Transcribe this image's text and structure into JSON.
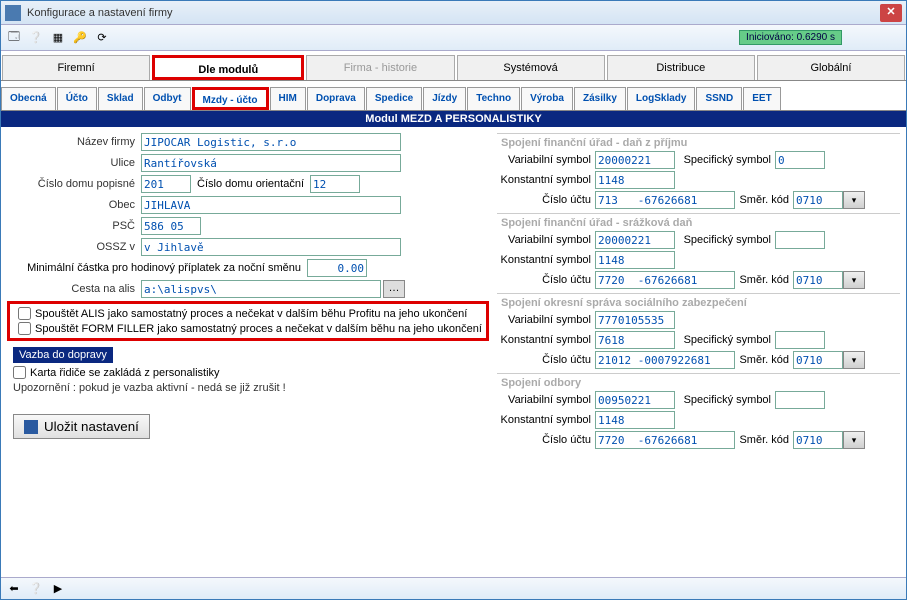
{
  "window": {
    "title": "Konfigurace a nastavení firmy"
  },
  "init_badge": "Iniciováno: 0.6290 s",
  "main_tabs": [
    "Firemní",
    "Dle modulů",
    "Firma - historie",
    "Systémová",
    "Distribuce",
    "Globální"
  ],
  "sub_tabs": [
    "Obecná",
    "Účto",
    "Sklad",
    "Odbyt",
    "Mzdy - účto",
    "HIM",
    "Doprava",
    "Spedice",
    "Jízdy",
    "Techno",
    "Výroba",
    "Zásilky",
    "LogSklady",
    "SSND",
    "EET"
  ],
  "module_header": "Modul  MEZD A PERSONALISTIKY",
  "labels": {
    "nazev": "Název firmy",
    "ulice": "Ulice",
    "cislo_pop": "Číslo domu popisné",
    "cislo_or": "Číslo domu orientační",
    "obec": "Obec",
    "psc": "PSČ",
    "ossz": "OSSZ v",
    "min_castka": "Minimální částka pro hodinový příplatek za noční směnu",
    "cesta": "Cesta na alis",
    "var_sym": "Variabilní symbol",
    "spec_sym": "Specifický symbol",
    "konst_sym": "Konstantní symbol",
    "cislo_uctu": "Číslo účtu",
    "smer_kod": "Směr. kód"
  },
  "values": {
    "nazev": "JIPOCAR Logistic, s.r.o",
    "ulice": "Rantířovská",
    "cislo_pop": "201",
    "cislo_or": "12",
    "obec": "JIHLAVA",
    "psc": "586 05",
    "ossz": "v Jihlavě",
    "min_castka": "0.00",
    "cesta": "a:\\alispvs\\"
  },
  "checks": {
    "alis": "Spouštět ALIS jako samostatný proces a nečekat v dalším běhu Profitu na jeho ukončení",
    "formfiller": "Spouštět FORM FILLER jako samostatný proces a nečekat v dalším běhu na jeho ukončení",
    "karta": "Karta řidiče se zakládá z personalistiky"
  },
  "vazba": "Vazba do dopravy",
  "note": "Upozornění : pokud je vazba aktivní - nedá se již zrušit !",
  "save": "Uložit nastavení",
  "sections": {
    "s1": {
      "title": "Spojení finanční úřad - daň z příjmu",
      "var": "20000221",
      "spec": "0",
      "konst": "1148",
      "ucet": "713   -67626681",
      "kod": "0710"
    },
    "s2": {
      "title": "Spojení finanční úřad - srážková daň",
      "var": "20000221",
      "spec": "",
      "konst": "1148",
      "ucet": "7720  -67626681",
      "kod": "0710"
    },
    "s3": {
      "title": "Spojení okresní správa sociálního zabezpečení",
      "var": "7770105535",
      "spec": "",
      "konst": "7618",
      "ucet": "21012 -0007922681",
      "kod": "0710"
    },
    "s4": {
      "title": "Spojení odbory",
      "var": "00950221",
      "spec": "",
      "konst": "1148",
      "ucet": "7720  -67626681",
      "kod": "0710"
    }
  }
}
